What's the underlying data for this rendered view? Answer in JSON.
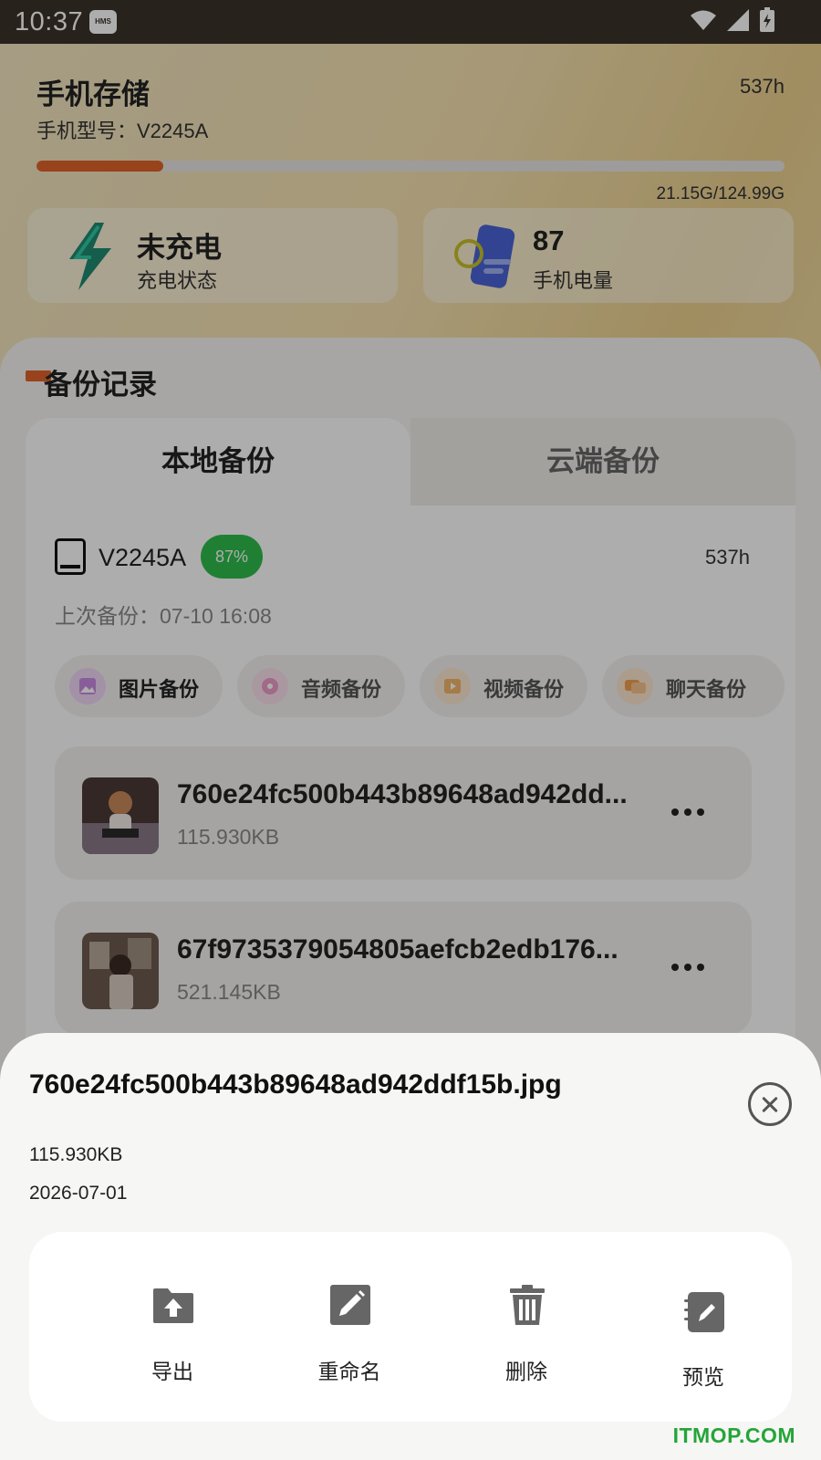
{
  "status_bar": {
    "time": "10:37",
    "badge": "HMS"
  },
  "storage": {
    "title": "手机存储",
    "hours": "537h",
    "model": "手机型号：V2245A",
    "used_fraction": 0.169,
    "usage": "21.15G/124.99G"
  },
  "stats": [
    {
      "value": "未充电",
      "label": "充电状态",
      "icon": "lightning-icon"
    },
    {
      "value": "87",
      "label": "手机电量",
      "icon": "battery-icon"
    }
  ],
  "backup": {
    "title": "备份记录",
    "tabs": [
      {
        "label": "本地备份",
        "active": true
      },
      {
        "label": "云端备份",
        "active": false
      }
    ],
    "device": {
      "name": "V2245A",
      "battery": "87%",
      "hours": "537h",
      "last_backup": "上次备份：07-10 16:08"
    },
    "categories": [
      {
        "label": "图片备份",
        "icon": "image-icon",
        "color": "#c98be0",
        "active": true
      },
      {
        "label": "音频备份",
        "icon": "audio-icon",
        "color": "#ee9cc8",
        "active": false
      },
      {
        "label": "视频备份",
        "icon": "video-icon",
        "color": "#f4b56a",
        "active": false
      },
      {
        "label": "聊天备份",
        "icon": "chat-icon",
        "color": "#f0a052",
        "active": false
      }
    ],
    "files": [
      {
        "name": "760e24fc500b443b89648ad942dd...",
        "size": "115.930KB"
      },
      {
        "name": "67f9735379054805aefcb2edb176...",
        "size": "521.145KB"
      }
    ]
  },
  "sheet": {
    "title": "760e24fc500b443b89648ad942ddf15b.jpg",
    "size": "115.930KB",
    "date": "2026-07-01",
    "actions": [
      {
        "label": "导出",
        "icon": "folder-upload-icon"
      },
      {
        "label": "重命名",
        "icon": "edit-icon"
      },
      {
        "label": "删除",
        "icon": "trash-icon"
      },
      {
        "label": "预览",
        "icon": "preview-icon"
      }
    ]
  },
  "watermark": "ITMOP.COM",
  "colors": {
    "accent": "#e0632a",
    "badge_green": "#2ebd4c",
    "icon_gray": "#666666"
  }
}
